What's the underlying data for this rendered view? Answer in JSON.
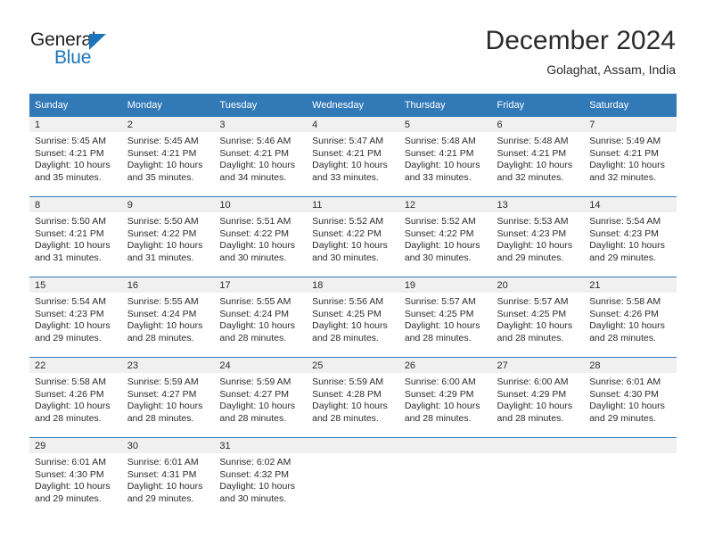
{
  "brand": {
    "name_top": "General",
    "name_bottom": "Blue",
    "flag_icon": "blue-triangle-flag-icon",
    "color_dark": "#231f20",
    "color_blue": "#1b75bb"
  },
  "header": {
    "title": "December 2024",
    "subtitle": "Golaghat, Assam, India"
  },
  "theme": {
    "header_bar": "#3279b8",
    "daynum_bg": "#f0f0f0",
    "text": "#2b2b2b",
    "row_divider": "#3279b8"
  },
  "weekday_headers": [
    "Sunday",
    "Monday",
    "Tuesday",
    "Wednesday",
    "Thursday",
    "Friday",
    "Saturday"
  ],
  "labels": {
    "sunrise_prefix": "Sunrise:",
    "sunset_prefix": "Sunset:",
    "daylight_prefix": "Daylight:"
  },
  "weeks": [
    [
      {
        "day": "1",
        "sunrise": "Sunrise: 5:45 AM",
        "sunset": "Sunset: 4:21 PM",
        "daylight_line1": "Daylight: 10 hours",
        "daylight_line2": "and 35 minutes."
      },
      {
        "day": "2",
        "sunrise": "Sunrise: 5:45 AM",
        "sunset": "Sunset: 4:21 PM",
        "daylight_line1": "Daylight: 10 hours",
        "daylight_line2": "and 35 minutes."
      },
      {
        "day": "3",
        "sunrise": "Sunrise: 5:46 AM",
        "sunset": "Sunset: 4:21 PM",
        "daylight_line1": "Daylight: 10 hours",
        "daylight_line2": "and 34 minutes."
      },
      {
        "day": "4",
        "sunrise": "Sunrise: 5:47 AM",
        "sunset": "Sunset: 4:21 PM",
        "daylight_line1": "Daylight: 10 hours",
        "daylight_line2": "and 33 minutes."
      },
      {
        "day": "5",
        "sunrise": "Sunrise: 5:48 AM",
        "sunset": "Sunset: 4:21 PM",
        "daylight_line1": "Daylight: 10 hours",
        "daylight_line2": "and 33 minutes."
      },
      {
        "day": "6",
        "sunrise": "Sunrise: 5:48 AM",
        "sunset": "Sunset: 4:21 PM",
        "daylight_line1": "Daylight: 10 hours",
        "daylight_line2": "and 32 minutes."
      },
      {
        "day": "7",
        "sunrise": "Sunrise: 5:49 AM",
        "sunset": "Sunset: 4:21 PM",
        "daylight_line1": "Daylight: 10 hours",
        "daylight_line2": "and 32 minutes."
      }
    ],
    [
      {
        "day": "8",
        "sunrise": "Sunrise: 5:50 AM",
        "sunset": "Sunset: 4:21 PM",
        "daylight_line1": "Daylight: 10 hours",
        "daylight_line2": "and 31 minutes."
      },
      {
        "day": "9",
        "sunrise": "Sunrise: 5:50 AM",
        "sunset": "Sunset: 4:22 PM",
        "daylight_line1": "Daylight: 10 hours",
        "daylight_line2": "and 31 minutes."
      },
      {
        "day": "10",
        "sunrise": "Sunrise: 5:51 AM",
        "sunset": "Sunset: 4:22 PM",
        "daylight_line1": "Daylight: 10 hours",
        "daylight_line2": "and 30 minutes."
      },
      {
        "day": "11",
        "sunrise": "Sunrise: 5:52 AM",
        "sunset": "Sunset: 4:22 PM",
        "daylight_line1": "Daylight: 10 hours",
        "daylight_line2": "and 30 minutes."
      },
      {
        "day": "12",
        "sunrise": "Sunrise: 5:52 AM",
        "sunset": "Sunset: 4:22 PM",
        "daylight_line1": "Daylight: 10 hours",
        "daylight_line2": "and 30 minutes."
      },
      {
        "day": "13",
        "sunrise": "Sunrise: 5:53 AM",
        "sunset": "Sunset: 4:23 PM",
        "daylight_line1": "Daylight: 10 hours",
        "daylight_line2": "and 29 minutes."
      },
      {
        "day": "14",
        "sunrise": "Sunrise: 5:54 AM",
        "sunset": "Sunset: 4:23 PM",
        "daylight_line1": "Daylight: 10 hours",
        "daylight_line2": "and 29 minutes."
      }
    ],
    [
      {
        "day": "15",
        "sunrise": "Sunrise: 5:54 AM",
        "sunset": "Sunset: 4:23 PM",
        "daylight_line1": "Daylight: 10 hours",
        "daylight_line2": "and 29 minutes."
      },
      {
        "day": "16",
        "sunrise": "Sunrise: 5:55 AM",
        "sunset": "Sunset: 4:24 PM",
        "daylight_line1": "Daylight: 10 hours",
        "daylight_line2": "and 28 minutes."
      },
      {
        "day": "17",
        "sunrise": "Sunrise: 5:55 AM",
        "sunset": "Sunset: 4:24 PM",
        "daylight_line1": "Daylight: 10 hours",
        "daylight_line2": "and 28 minutes."
      },
      {
        "day": "18",
        "sunrise": "Sunrise: 5:56 AM",
        "sunset": "Sunset: 4:25 PM",
        "daylight_line1": "Daylight: 10 hours",
        "daylight_line2": "and 28 minutes."
      },
      {
        "day": "19",
        "sunrise": "Sunrise: 5:57 AM",
        "sunset": "Sunset: 4:25 PM",
        "daylight_line1": "Daylight: 10 hours",
        "daylight_line2": "and 28 minutes."
      },
      {
        "day": "20",
        "sunrise": "Sunrise: 5:57 AM",
        "sunset": "Sunset: 4:25 PM",
        "daylight_line1": "Daylight: 10 hours",
        "daylight_line2": "and 28 minutes."
      },
      {
        "day": "21",
        "sunrise": "Sunrise: 5:58 AM",
        "sunset": "Sunset: 4:26 PM",
        "daylight_line1": "Daylight: 10 hours",
        "daylight_line2": "and 28 minutes."
      }
    ],
    [
      {
        "day": "22",
        "sunrise": "Sunrise: 5:58 AM",
        "sunset": "Sunset: 4:26 PM",
        "daylight_line1": "Daylight: 10 hours",
        "daylight_line2": "and 28 minutes."
      },
      {
        "day": "23",
        "sunrise": "Sunrise: 5:59 AM",
        "sunset": "Sunset: 4:27 PM",
        "daylight_line1": "Daylight: 10 hours",
        "daylight_line2": "and 28 minutes."
      },
      {
        "day": "24",
        "sunrise": "Sunrise: 5:59 AM",
        "sunset": "Sunset: 4:27 PM",
        "daylight_line1": "Daylight: 10 hours",
        "daylight_line2": "and 28 minutes."
      },
      {
        "day": "25",
        "sunrise": "Sunrise: 5:59 AM",
        "sunset": "Sunset: 4:28 PM",
        "daylight_line1": "Daylight: 10 hours",
        "daylight_line2": "and 28 minutes."
      },
      {
        "day": "26",
        "sunrise": "Sunrise: 6:00 AM",
        "sunset": "Sunset: 4:29 PM",
        "daylight_line1": "Daylight: 10 hours",
        "daylight_line2": "and 28 minutes."
      },
      {
        "day": "27",
        "sunrise": "Sunrise: 6:00 AM",
        "sunset": "Sunset: 4:29 PM",
        "daylight_line1": "Daylight: 10 hours",
        "daylight_line2": "and 28 minutes."
      },
      {
        "day": "28",
        "sunrise": "Sunrise: 6:01 AM",
        "sunset": "Sunset: 4:30 PM",
        "daylight_line1": "Daylight: 10 hours",
        "daylight_line2": "and 29 minutes."
      }
    ],
    [
      {
        "day": "29",
        "sunrise": "Sunrise: 6:01 AM",
        "sunset": "Sunset: 4:30 PM",
        "daylight_line1": "Daylight: 10 hours",
        "daylight_line2": "and 29 minutes."
      },
      {
        "day": "30",
        "sunrise": "Sunrise: 6:01 AM",
        "sunset": "Sunset: 4:31 PM",
        "daylight_line1": "Daylight: 10 hours",
        "daylight_line2": "and 29 minutes."
      },
      {
        "day": "31",
        "sunrise": "Sunrise: 6:02 AM",
        "sunset": "Sunset: 4:32 PM",
        "daylight_line1": "Daylight: 10 hours",
        "daylight_line2": "and 30 minutes."
      },
      {
        "day": "",
        "sunrise": "",
        "sunset": "",
        "daylight_line1": "",
        "daylight_line2": ""
      },
      {
        "day": "",
        "sunrise": "",
        "sunset": "",
        "daylight_line1": "",
        "daylight_line2": ""
      },
      {
        "day": "",
        "sunrise": "",
        "sunset": "",
        "daylight_line1": "",
        "daylight_line2": ""
      },
      {
        "day": "",
        "sunrise": "",
        "sunset": "",
        "daylight_line1": "",
        "daylight_line2": ""
      }
    ]
  ]
}
